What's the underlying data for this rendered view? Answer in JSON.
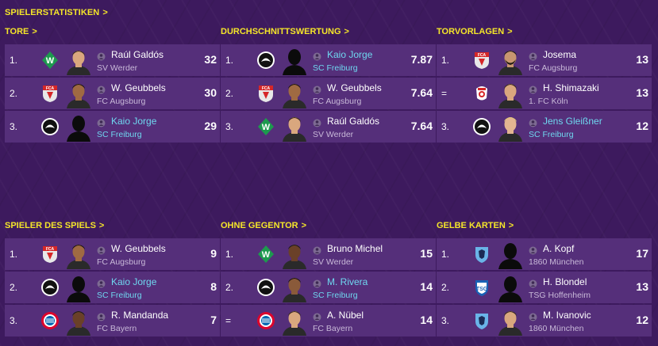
{
  "header": {
    "title": "SPIELERSTATISTIKEN",
    "chevron": ">"
  },
  "sections": [
    {
      "title": "TORE",
      "rows": [
        {
          "rank": "1.",
          "club": "SV Werder",
          "crest": "werder",
          "name": "Raúl Galdós",
          "value": "32",
          "link": false,
          "face": "light"
        },
        {
          "rank": "2.",
          "club": "FC Augsburg",
          "crest": "augsburg",
          "name": "W. Geubbels",
          "value": "30",
          "link": false,
          "face": "curly"
        },
        {
          "rank": "3.",
          "club": "SC Freiburg",
          "crest": "freiburg",
          "name": "Kaio Jorge",
          "value": "29",
          "link": true,
          "face": "silhouette"
        }
      ]
    },
    {
      "title": "DURCHSCHNITTSWERTUNG",
      "rows": [
        {
          "rank": "1.",
          "club": "SC Freiburg",
          "crest": "freiburg",
          "name": "Kaio Jorge",
          "value": "7.87",
          "link": true,
          "face": "silhouette"
        },
        {
          "rank": "2.",
          "club": "FC Augsburg",
          "crest": "augsburg",
          "name": "W. Geubbels",
          "value": "7.64",
          "link": false,
          "face": "curly"
        },
        {
          "rank": "3.",
          "club": "SV Werder",
          "crest": "werder",
          "name": "Raúl Galdós",
          "value": "7.64",
          "link": false,
          "face": "light"
        }
      ]
    },
    {
      "title": "TORVORLAGEN",
      "rows": [
        {
          "rank": "1.",
          "club": "FC Augsburg",
          "crest": "augsburg",
          "name": "Josema",
          "value": "13",
          "link": false,
          "face": "beard"
        },
        {
          "rank": "=",
          "club": "1. FC Köln",
          "crest": "koeln",
          "name": "H. Shimazaki",
          "value": "13",
          "link": false,
          "face": "light"
        },
        {
          "rank": "3.",
          "club": "SC Freiburg",
          "crest": "freiburg",
          "name": "Jens Gleißner",
          "value": "12",
          "link": true,
          "face": "blond"
        }
      ]
    },
    {
      "title": "SPIELER DES SPIELS",
      "rows": [
        {
          "rank": "1.",
          "club": "FC Augsburg",
          "crest": "augsburg",
          "name": "W. Geubbels",
          "value": "9",
          "link": false,
          "face": "curly"
        },
        {
          "rank": "2.",
          "club": "SC Freiburg",
          "crest": "freiburg",
          "name": "Kaio Jorge",
          "value": "8",
          "link": true,
          "face": "silhouette"
        },
        {
          "rank": "3.",
          "club": "FC Bayern",
          "crest": "bayern",
          "name": "R. Mandanda",
          "value": "7",
          "link": false,
          "face": "dark"
        }
      ]
    },
    {
      "title": "OHNE GEGENTOR",
      "rows": [
        {
          "rank": "1.",
          "club": "SV Werder",
          "crest": "werder",
          "name": "Bruno Michel",
          "value": "15",
          "link": false,
          "face": "dark"
        },
        {
          "rank": "2.",
          "club": "SC Freiburg",
          "crest": "freiburg",
          "name": "M. Rivera",
          "value": "14",
          "link": true,
          "face": "brown"
        },
        {
          "rank": "=",
          "club": "FC Bayern",
          "crest": "bayern",
          "name": "A. Nübel",
          "value": "14",
          "link": false,
          "face": "light"
        }
      ]
    },
    {
      "title": "GELBE KARTEN",
      "rows": [
        {
          "rank": "1.",
          "club": "1860 München",
          "crest": "muenchen1860",
          "name": "A. Kopf",
          "value": "17",
          "link": false,
          "face": "silhouette"
        },
        {
          "rank": "2.",
          "club": "TSG Hoffenheim",
          "crest": "hoffenheim",
          "name": "H. Blondel",
          "value": "13",
          "link": false,
          "face": "silhouette"
        },
        {
          "rank": "3.",
          "club": "1860 München",
          "crest": "muenchen1860",
          "name": "M. Ivanovic",
          "value": "12",
          "link": false,
          "face": "light"
        }
      ]
    }
  ],
  "colors": {
    "accent": "#f5e629",
    "link": "#6fd8f0",
    "row_bg": "#552f7a",
    "background": "#3d1a5e"
  }
}
